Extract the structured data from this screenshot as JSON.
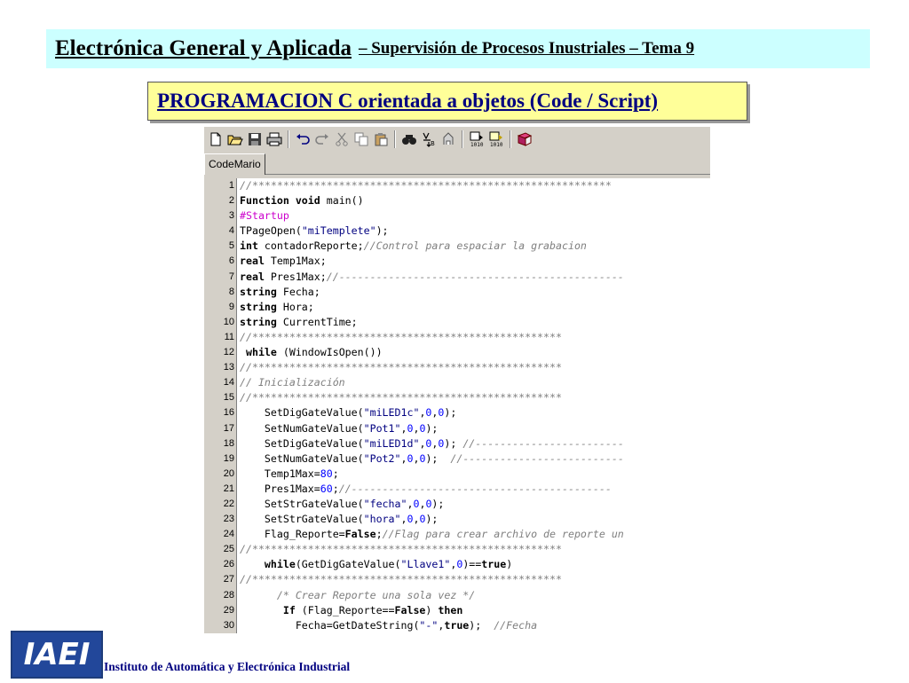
{
  "header": {
    "title": "Electrónica General y Aplicada",
    "subtitle": "– Supervisión de Procesos Inustriales  –   Tema 9"
  },
  "section_title": "PROGRAMACION  C orientada a objetos  (Code / Script)",
  "editor": {
    "toolbar_icons": [
      "new-file-icon",
      "open-folder-icon",
      "save-icon",
      "print-icon",
      "undo-icon",
      "redo-icon",
      "cut-icon",
      "copy-icon",
      "paste-icon",
      "find-icon",
      "find-replace-icon",
      "compile-icon",
      "step-icon",
      "run-icon",
      "book-icon"
    ],
    "tab_label": "CodeMario",
    "lines": [
      {
        "n": "1",
        "segs": [
          {
            "t": "//**********************************************************",
            "c": "c"
          }
        ]
      },
      {
        "n": "2",
        "segs": [
          {
            "t": "Function void",
            "c": "k"
          },
          {
            "t": " main()",
            "c": ""
          }
        ]
      },
      {
        "n": "3",
        "segs": [
          {
            "t": "#Startup",
            "c": "p"
          }
        ]
      },
      {
        "n": "4",
        "segs": [
          {
            "t": "TPageOpen(",
            "c": ""
          },
          {
            "t": "\"miTemplete\"",
            "c": "s"
          },
          {
            "t": ");",
            "c": ""
          }
        ]
      },
      {
        "n": "5",
        "segs": [
          {
            "t": "int",
            "c": "k"
          },
          {
            "t": " contadorReporte;",
            "c": ""
          },
          {
            "t": "//Control para espaciar la grabacion",
            "c": "c"
          }
        ]
      },
      {
        "n": "6",
        "segs": [
          {
            "t": "real",
            "c": "k"
          },
          {
            "t": " Temp1Max;",
            "c": ""
          }
        ]
      },
      {
        "n": "7",
        "segs": [
          {
            "t": "real",
            "c": "k"
          },
          {
            "t": " Pres1Max;",
            "c": ""
          },
          {
            "t": "//----------------------------------------------",
            "c": "c"
          }
        ]
      },
      {
        "n": "8",
        "segs": [
          {
            "t": "string",
            "c": "k"
          },
          {
            "t": " Fecha;",
            "c": ""
          }
        ]
      },
      {
        "n": "9",
        "segs": [
          {
            "t": "string",
            "c": "k"
          },
          {
            "t": " Hora;",
            "c": ""
          }
        ]
      },
      {
        "n": "10",
        "segs": [
          {
            "t": "string",
            "c": "k"
          },
          {
            "t": " CurrentTime;",
            "c": ""
          }
        ]
      },
      {
        "n": "11",
        "segs": [
          {
            "t": "//**************************************************",
            "c": "c"
          }
        ]
      },
      {
        "n": "12",
        "segs": [
          {
            "t": " while",
            "c": "k"
          },
          {
            "t": " (WindowIsOpen())",
            "c": ""
          }
        ]
      },
      {
        "n": "13",
        "segs": [
          {
            "t": "//**************************************************",
            "c": "c"
          }
        ]
      },
      {
        "n": "14",
        "segs": [
          {
            "t": "// Inicialización",
            "c": "c"
          }
        ]
      },
      {
        "n": "15",
        "segs": [
          {
            "t": "//**************************************************",
            "c": "c"
          }
        ]
      },
      {
        "n": "16",
        "segs": [
          {
            "t": "    SetDigGateValue(",
            "c": ""
          },
          {
            "t": "\"miLED1c\"",
            "c": "s"
          },
          {
            "t": ",",
            "c": ""
          },
          {
            "t": "0",
            "c": "n"
          },
          {
            "t": ",",
            "c": ""
          },
          {
            "t": "0",
            "c": "n"
          },
          {
            "t": ");",
            "c": ""
          }
        ]
      },
      {
        "n": "17",
        "segs": [
          {
            "t": "    SetNumGateValue(",
            "c": ""
          },
          {
            "t": "\"Pot1\"",
            "c": "s"
          },
          {
            "t": ",",
            "c": ""
          },
          {
            "t": "0",
            "c": "n"
          },
          {
            "t": ",",
            "c": ""
          },
          {
            "t": "0",
            "c": "n"
          },
          {
            "t": ");",
            "c": ""
          }
        ]
      },
      {
        "n": "18",
        "segs": [
          {
            "t": "    SetDigGateValue(",
            "c": ""
          },
          {
            "t": "\"miLED1d\"",
            "c": "s"
          },
          {
            "t": ",",
            "c": ""
          },
          {
            "t": "0",
            "c": "n"
          },
          {
            "t": ",",
            "c": ""
          },
          {
            "t": "0",
            "c": "n"
          },
          {
            "t": "); ",
            "c": ""
          },
          {
            "t": "//------------------------",
            "c": "c"
          }
        ]
      },
      {
        "n": "19",
        "segs": [
          {
            "t": "    SetNumGateValue(",
            "c": ""
          },
          {
            "t": "\"Pot2\"",
            "c": "s"
          },
          {
            "t": ",",
            "c": ""
          },
          {
            "t": "0",
            "c": "n"
          },
          {
            "t": ",",
            "c": ""
          },
          {
            "t": "0",
            "c": "n"
          },
          {
            "t": ");  ",
            "c": ""
          },
          {
            "t": "//--------------------------",
            "c": "c"
          }
        ]
      },
      {
        "n": "20",
        "segs": [
          {
            "t": "    Temp1Max=",
            "c": ""
          },
          {
            "t": "80",
            "c": "n"
          },
          {
            "t": ";",
            "c": ""
          }
        ]
      },
      {
        "n": "21",
        "segs": [
          {
            "t": "    Pres1Max=",
            "c": ""
          },
          {
            "t": "60",
            "c": "n"
          },
          {
            "t": ";",
            "c": ""
          },
          {
            "t": "//------------------------------------------",
            "c": "c"
          }
        ]
      },
      {
        "n": "22",
        "segs": [
          {
            "t": "    SetStrGateValue(",
            "c": ""
          },
          {
            "t": "\"fecha\"",
            "c": "s"
          },
          {
            "t": ",",
            "c": ""
          },
          {
            "t": "0",
            "c": "n"
          },
          {
            "t": ",",
            "c": ""
          },
          {
            "t": "0",
            "c": "n"
          },
          {
            "t": ");",
            "c": ""
          }
        ]
      },
      {
        "n": "23",
        "segs": [
          {
            "t": "    SetStrGateValue(",
            "c": ""
          },
          {
            "t": "\"hora\"",
            "c": "s"
          },
          {
            "t": ",",
            "c": ""
          },
          {
            "t": "0",
            "c": "n"
          },
          {
            "t": ",",
            "c": ""
          },
          {
            "t": "0",
            "c": "n"
          },
          {
            "t": ");",
            "c": ""
          }
        ]
      },
      {
        "n": "24",
        "segs": [
          {
            "t": "    Flag_Reporte=",
            "c": ""
          },
          {
            "t": "False",
            "c": "k"
          },
          {
            "t": ";",
            "c": ""
          },
          {
            "t": "//Flag para crear archivo de reporte un",
            "c": "c"
          }
        ]
      },
      {
        "n": "25",
        "segs": [
          {
            "t": "//**************************************************",
            "c": "c"
          }
        ]
      },
      {
        "n": "26",
        "segs": [
          {
            "t": "    while",
            "c": "k"
          },
          {
            "t": "(GetDigGateValue(",
            "c": ""
          },
          {
            "t": "\"Llave1\"",
            "c": "s"
          },
          {
            "t": ",",
            "c": ""
          },
          {
            "t": "0",
            "c": "n"
          },
          {
            "t": ")==",
            "c": ""
          },
          {
            "t": "true",
            "c": "k"
          },
          {
            "t": ")",
            "c": ""
          }
        ]
      },
      {
        "n": "27",
        "segs": [
          {
            "t": "//**************************************************",
            "c": "c"
          }
        ]
      },
      {
        "n": "28",
        "segs": [
          {
            "t": "      /* Crear Reporte una sola vez */",
            "c": "c"
          }
        ]
      },
      {
        "n": "29",
        "segs": [
          {
            "t": "       If",
            "c": "k"
          },
          {
            "t": " (Flag_Reporte==",
            "c": ""
          },
          {
            "t": "False",
            "c": "k"
          },
          {
            "t": ") ",
            "c": ""
          },
          {
            "t": "then",
            "c": "k"
          }
        ]
      },
      {
        "n": "30",
        "segs": [
          {
            "t": "         Fecha=GetDateString(",
            "c": ""
          },
          {
            "t": "\"-\"",
            "c": "s"
          },
          {
            "t": ",",
            "c": ""
          },
          {
            "t": "true",
            "c": "k"
          },
          {
            "t": ");  ",
            "c": ""
          },
          {
            "t": "//Fecha",
            "c": "c"
          }
        ]
      }
    ]
  },
  "footer": {
    "logo_text": "IAEI",
    "institution": "Instituto de Automática y Electrónica Industrial"
  }
}
